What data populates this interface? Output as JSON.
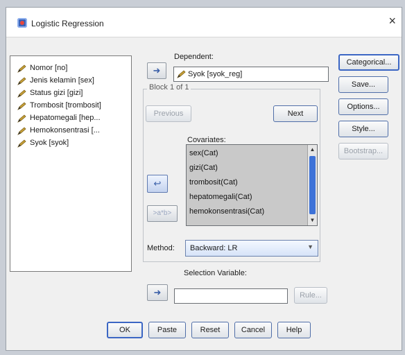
{
  "window": {
    "title": "Logistic Regression",
    "close_glyph": "×"
  },
  "variables": [
    {
      "label": "Nomor [no]"
    },
    {
      "label": "Jenis kelamin [sex]"
    },
    {
      "label": "Status gizi [gizi]"
    },
    {
      "label": "Trombosit [trombosit]"
    },
    {
      "label": "Hepatomegali [hep..."
    },
    {
      "label": "Hemokonsentrasi [..."
    },
    {
      "label": "Syok [syok]"
    }
  ],
  "dependent": {
    "label": "Dependent:",
    "value": "Syok [syok_reg]"
  },
  "block": {
    "label": "Block 1 of 1",
    "previous": "Previous",
    "next": "Next"
  },
  "covariates": {
    "label": "Covariates:",
    "items": [
      "sex(Cat)",
      "gizi(Cat)",
      "trombosit(Cat)",
      "hepatomegali(Cat)",
      "hemokonsentrasi(Cat)"
    ]
  },
  "interaction_button": ">a*b>",
  "method": {
    "label": "Method:",
    "value": "Backward: LR"
  },
  "selection_variable": {
    "label": "Selection Variable:",
    "value": "",
    "rule": "Rule..."
  },
  "side_buttons": {
    "categorical": "Categorical...",
    "save": "Save...",
    "options": "Options...",
    "style": "Style...",
    "bootstrap": "Bootstrap..."
  },
  "bottom_buttons": {
    "ok": "OK",
    "paste": "Paste",
    "reset": "Reset",
    "cancel": "Cancel",
    "help": "Help"
  },
  "icons": {
    "arrow": "right-arrow-icon",
    "variable": "pencil-icon"
  },
  "colors": {
    "accent": "#3b66c4",
    "selection": "#c9c9c9",
    "scroll_thumb": "#3d72d8"
  }
}
